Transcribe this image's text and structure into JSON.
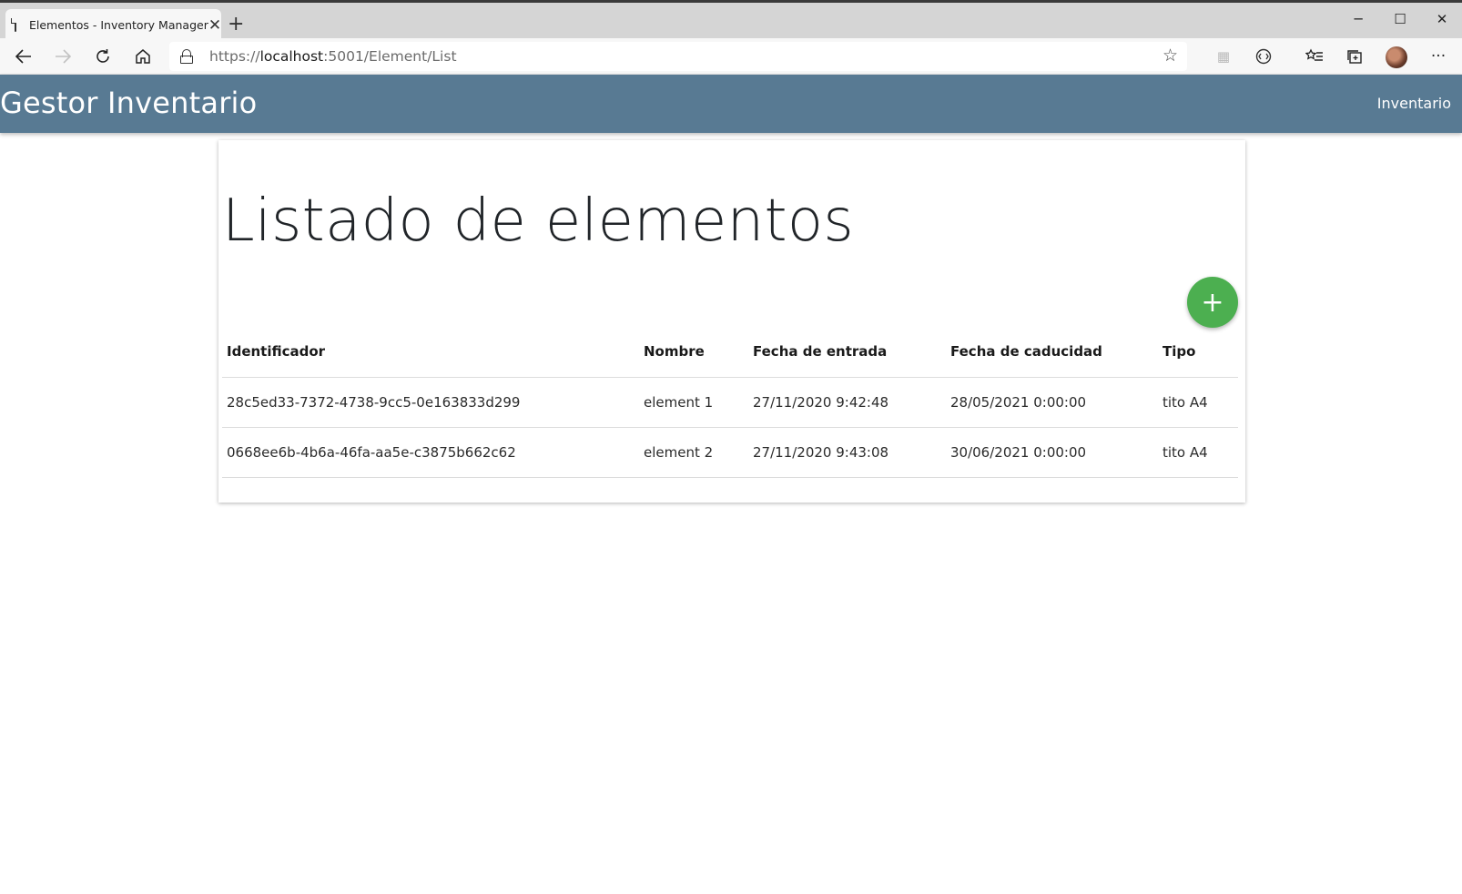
{
  "browser": {
    "tab_title": "Elementos - Inventory Manager",
    "url_scheme": "https://",
    "url_host": "localhost",
    "url_rest": ":5001/Element/List",
    "icons": [
      "page-icon",
      "close-icon",
      "plus-icon",
      "back-icon",
      "forward-icon",
      "refresh-icon",
      "home-icon",
      "lock-icon",
      "star-icon",
      "extension-icon",
      "reader-icon",
      "favorites-icon",
      "collections-icon",
      "more-icon"
    ]
  },
  "navbar": {
    "brand": "Gestor Inventario",
    "link": "Inventario",
    "color": "#587a93"
  },
  "main": {
    "title": "Listado de elementos",
    "add_button_label": "+",
    "add_button_color": "#4caf50",
    "table": {
      "headers": [
        "Identificador",
        "Nombre",
        "Fecha de entrada",
        "Fecha de caducidad",
        "Tipo"
      ],
      "rows": [
        [
          "28c5ed33-7372-4738-9cc5-0e163833d299",
          "element 1",
          "27/11/2020 9:42:48",
          "28/05/2021 0:00:00",
          "tito A4"
        ],
        [
          "0668ee6b-4b6a-46fa-aa5e-c3875b662c62",
          "element 2",
          "27/11/2020 9:43:08",
          "30/06/2021 0:00:00",
          "tito A4"
        ]
      ]
    }
  }
}
